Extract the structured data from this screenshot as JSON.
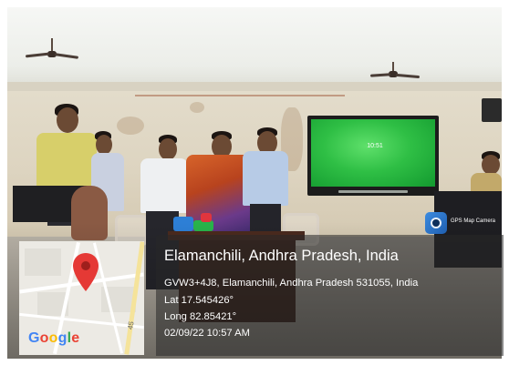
{
  "overlay": {
    "app_badge": "GPS Map Camera",
    "location_title": "Elamanchili, Andhra Pradesh, India",
    "address": "GVW3+4J8, Elamanchili, Andhra Pradesh 531055, India",
    "latitude": "Lat 17.545426°",
    "longitude": "Long 82.85421°",
    "datetime": "02/09/22 10:57 AM"
  },
  "map": {
    "brand_letters": [
      "G",
      "o",
      "o",
      "g",
      "l",
      "e"
    ],
    "brand_colors": [
      "#4285F4",
      "#EA4335",
      "#FBBC05",
      "#4285F4",
      "#34A853",
      "#EA4335"
    ],
    "road_number": "45",
    "pin_color": "#E53935"
  },
  "screen": {
    "clock": "10:51"
  }
}
